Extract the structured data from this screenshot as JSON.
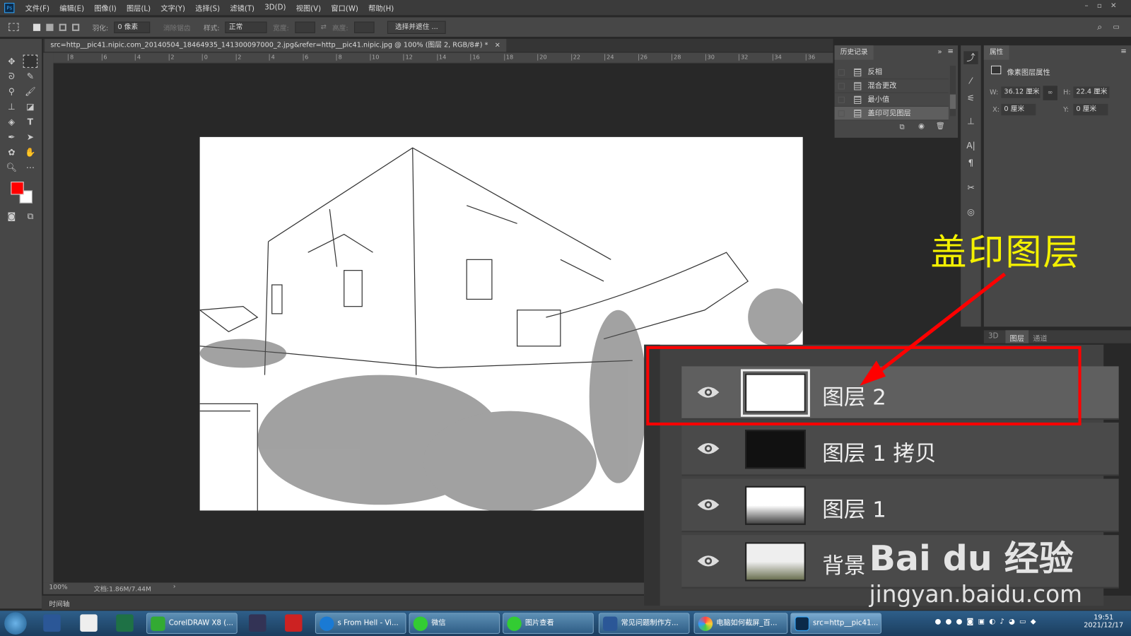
{
  "app": {
    "logo": "Ps"
  },
  "menu": [
    "文件(F)",
    "编辑(E)",
    "图像(I)",
    "图层(L)",
    "文字(Y)",
    "选择(S)",
    "滤镜(T)",
    "3D(D)",
    "视图(V)",
    "窗口(W)",
    "帮助(H)"
  ],
  "options": {
    "feather_label": "羽化:",
    "feather_value": "0 像素",
    "antialias_label": "消除锯齿",
    "style_label": "样式:",
    "style_value": "正常",
    "width_label": "宽度:",
    "height_label": "高度:",
    "select_mask_button": "选择并遮住 ..."
  },
  "document": {
    "tab_title": "src=http__pic41.nipic.com_20140504_18464935_141300097000_2.jpg&refer=http__pic41.nipic.jpg @ 100% (图层 2, RGB/8#) *",
    "close": "×"
  },
  "ruler_top_ticks": [
    "8",
    "6",
    "4",
    "2",
    "0",
    "2",
    "4",
    "6",
    "8",
    "10",
    "12",
    "14",
    "16",
    "18",
    "20",
    "22",
    "24",
    "26",
    "28",
    "30",
    "32",
    "34",
    "36"
  ],
  "status": {
    "zoom": "100%",
    "doc_size": "文档:1.86M/7.44M",
    "arrow": "›"
  },
  "timeline_label": "时间轴",
  "history": {
    "tab": "历史记录",
    "items": [
      "反相",
      "混合更改",
      "最小值",
      "盖印可见图层"
    ],
    "selected_index": 3
  },
  "properties": {
    "tab": "属性",
    "title": "像素图层属性",
    "w_label": "W:",
    "w_value": "36.12 厘米",
    "h_label": "H:",
    "h_value": "22.4 厘米",
    "x_label": "X:",
    "x_value": "0 厘米",
    "y_label": "Y:",
    "y_value": "0 厘米"
  },
  "layers_tabs": [
    "3D",
    "图层",
    "通道"
  ],
  "layers": [
    {
      "name": "图层 2",
      "selected": true
    },
    {
      "name": "图层 1 拷贝",
      "selected": false
    },
    {
      "name": "图层 1",
      "selected": false
    },
    {
      "name": "背景",
      "selected": false
    }
  ],
  "annotation": {
    "text": "盖印图层",
    "color": "#f3f000",
    "arrow_color": "#ff0000"
  },
  "watermark": {
    "brand": "Bai du 经验",
    "url": "jingyan.baidu.com"
  },
  "taskbar": {
    "tasks": [
      "CorelDRAW X8 (...",
      "s From Hell - Vi...",
      "微信",
      "图片查看",
      "常见问题制作方...",
      "电脑如何截屏_百...",
      "src=http__pic41..."
    ],
    "time": "19:51",
    "date": "2021/12/17"
  }
}
